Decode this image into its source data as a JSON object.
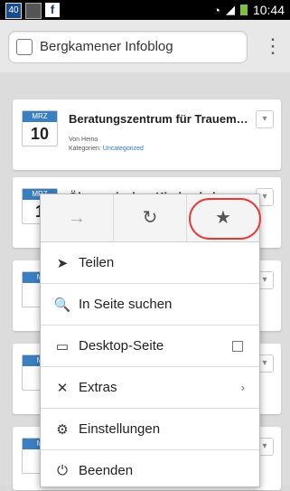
{
  "status": {
    "badge": "40",
    "fb": "f",
    "time": "10:44"
  },
  "urlbar": {
    "title": "Bergkamener Infoblog",
    "menu_glyph": "⋮"
  },
  "posts": [
    {
      "month": "MRZ",
      "day": "10",
      "title": "Beratungszentrum für Trauemd…",
      "author": "Von Heino",
      "category_label": "Kategorien:",
      "category": "Uncategorized"
    },
    {
      "month": "MRZ",
      "day": "1",
      "title": "Ökumenisches Kirchenkabarett…"
    },
    {
      "month": "M",
      "day": ""
    },
    {
      "month": "M",
      "day": ""
    },
    {
      "month": "M",
      "day": ""
    },
    {
      "month": "M",
      "day": ""
    }
  ],
  "menu": {
    "quick": {
      "forward_icon": "→",
      "reload_icon": "↻",
      "bookmark_icon": "★"
    },
    "items": [
      {
        "icon": "➤",
        "label": "Teilen"
      },
      {
        "icon": "🔍",
        "label": "In Seite suchen"
      },
      {
        "icon": "▭",
        "label": "Desktop-Seite"
      },
      {
        "icon": "✕",
        "label": "Extras",
        "trail": "›"
      },
      {
        "icon": "⚙",
        "label": "Einstellungen"
      },
      {
        "icon": "⏻",
        "label": "Beenden"
      }
    ]
  }
}
